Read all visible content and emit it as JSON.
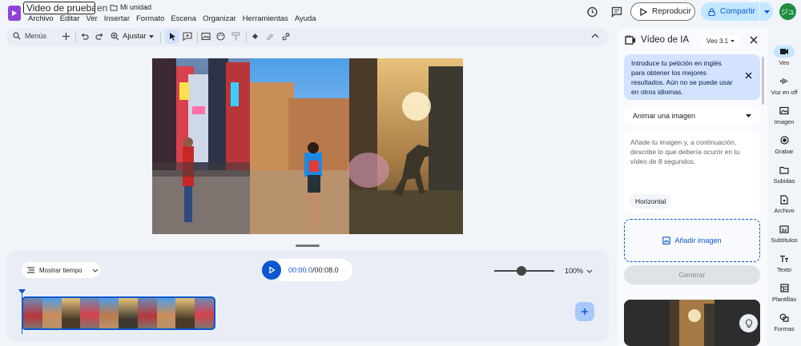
{
  "header": {
    "doc_title": "Video de prueba",
    "in_label": "en",
    "folder": "Mi unidad",
    "menu": [
      "Archivo",
      "Editar",
      "Ver",
      "Insertar",
      "Formato",
      "Escena",
      "Organizar",
      "Herramientas",
      "Ayuda"
    ],
    "play_label": "Reproducir",
    "share_label": "Compartir",
    "avatar_initials": "ジュ"
  },
  "toolbar": {
    "search_label": "Menús",
    "fit_label": "Ajustar"
  },
  "timeline": {
    "show_time_label": "Mostrar tiempo",
    "current_time": "00:00.0",
    "separator": " / ",
    "total_time": "00:08.0",
    "zoom_percent": "100%",
    "zoom_level": 0.45
  },
  "panel": {
    "title": "Vídeo de IA",
    "model": "Veo 3.1",
    "info": "Introduce tu petición en inglés para obtener los mejores resultados. Aún no se puede usar en otros idiomas.",
    "mode_select": "Animar una imagen",
    "prompt_placeholder": "Añade tu imagen y, a continuación, describe lo que debería ocurrir en tu vídeo de 8 segundos.",
    "orientation": "Horizontal",
    "add_image_label": "Añadir imagen",
    "generate_label": "Generar"
  },
  "rail": [
    {
      "label": "Veo",
      "icon": "veo-icon",
      "active": true
    },
    {
      "label": "Voz en off",
      "icon": "voiceover-icon",
      "active": false
    },
    {
      "label": "Imagen",
      "icon": "image-icon",
      "active": false
    },
    {
      "label": "Grabar",
      "icon": "record-icon",
      "active": false
    },
    {
      "label": "Subidas",
      "icon": "folder-icon",
      "active": false
    },
    {
      "label": "Archivo",
      "icon": "file-icon",
      "active": false
    },
    {
      "label": "Subtítulos",
      "icon": "subtitles-icon",
      "active": false
    },
    {
      "label": "Texto",
      "icon": "text-icon",
      "active": false
    },
    {
      "label": "Plantillas",
      "icon": "templates-icon",
      "active": false
    },
    {
      "label": "Formas",
      "icon": "shapes-icon",
      "active": false
    }
  ],
  "colors": {
    "accent": "#0b57d0",
    "share_bg": "#c2e7ff",
    "info_bg": "#d3e3fd",
    "logo": "#8e44d9",
    "avatar": "#1e8e3e"
  }
}
